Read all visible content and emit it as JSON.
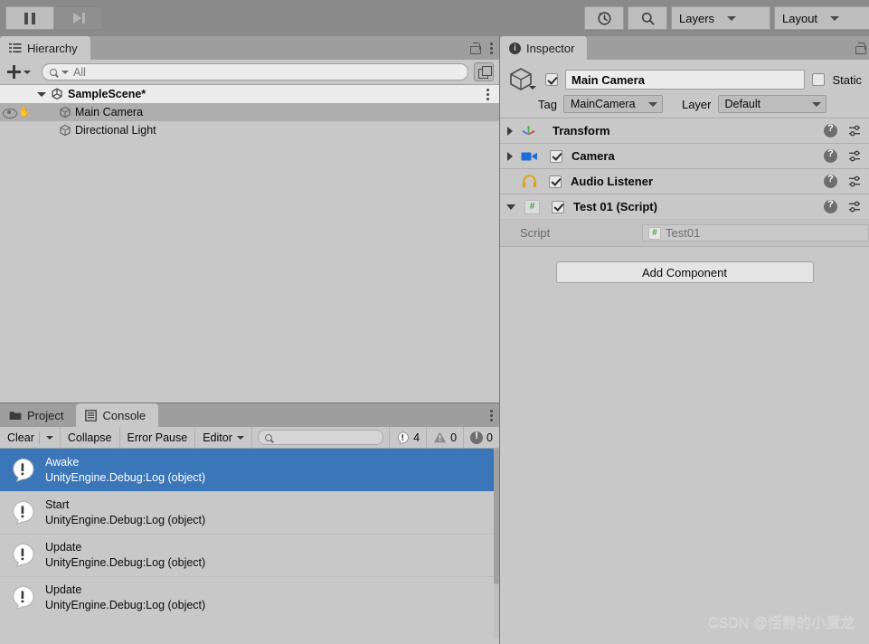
{
  "toolbar": {
    "pause_button": "pause-icon",
    "step_button": "step-icon",
    "history_button": "undo-history-icon",
    "search_button": "search-icon",
    "layers_label": "Layers",
    "layout_label": "Layout"
  },
  "hierarchy": {
    "tab_label": "Hierarchy",
    "add_label": "+",
    "search_placeholder": "All",
    "search_value": "",
    "items": [
      {
        "label": "SampleScene*",
        "type": "scene",
        "depth": 0,
        "expanded": true,
        "selected": false
      },
      {
        "label": "Main Camera",
        "type": "gameobject",
        "depth": 1,
        "expanded": false,
        "selected": true
      },
      {
        "label": "Directional Light",
        "type": "gameobject",
        "depth": 1,
        "expanded": false,
        "selected": false
      }
    ]
  },
  "console": {
    "tabs": [
      {
        "label": "Project",
        "active": false,
        "icon": "folder-icon"
      },
      {
        "label": "Console",
        "active": true,
        "icon": "console-icon"
      }
    ],
    "toolbar": {
      "clear_label": "Clear",
      "collapse_label": "Collapse",
      "error_pause_label": "Error Pause",
      "editor_label": "Editor",
      "search_placeholder": "",
      "search_value": ""
    },
    "counts": {
      "errors": "4",
      "warnings": "0",
      "infos": "0"
    },
    "logs": [
      {
        "message": "Awake",
        "stack": "UnityEngine.Debug:Log (object)",
        "selected": true
      },
      {
        "message": "Start",
        "stack": "UnityEngine.Debug:Log (object)",
        "selected": false
      },
      {
        "message": "Update",
        "stack": "UnityEngine.Debug:Log (object)",
        "selected": false
      },
      {
        "message": "Update",
        "stack": "UnityEngine.Debug:Log (object)",
        "selected": false
      }
    ]
  },
  "inspector": {
    "tab_label": "Inspector",
    "object_name": "Main Camera",
    "object_enabled": true,
    "static_label": "Static",
    "static_checked": false,
    "tag_label": "Tag",
    "tag_value": "MainCamera",
    "layer_label": "Layer",
    "layer_value": "Default",
    "components": [
      {
        "name": "Transform",
        "expanded": false,
        "has_toggle": false,
        "enabled": false,
        "icon": "transform-icon"
      },
      {
        "name": "Camera",
        "expanded": false,
        "has_toggle": true,
        "enabled": true,
        "icon": "camera-icon"
      },
      {
        "name": "Audio Listener",
        "expanded": null,
        "has_toggle": true,
        "enabled": true,
        "icon": "headphones-icon"
      },
      {
        "name": "Test 01 (Script)",
        "expanded": true,
        "has_toggle": true,
        "enabled": true,
        "icon": "script-icon"
      }
    ],
    "script_field_label": "Script",
    "script_field_value": "Test01",
    "add_component_label": "Add Component"
  },
  "watermark": "CSDN @恬静的小魔龙",
  "colors": {
    "panel_bg": "#c8c8c8",
    "toolbar_bg": "#8a8a8a",
    "tabbar_bg": "#9e9e9e",
    "selection_blue": "#3a76b8",
    "hierarchy_selected": "#aeaeae"
  }
}
